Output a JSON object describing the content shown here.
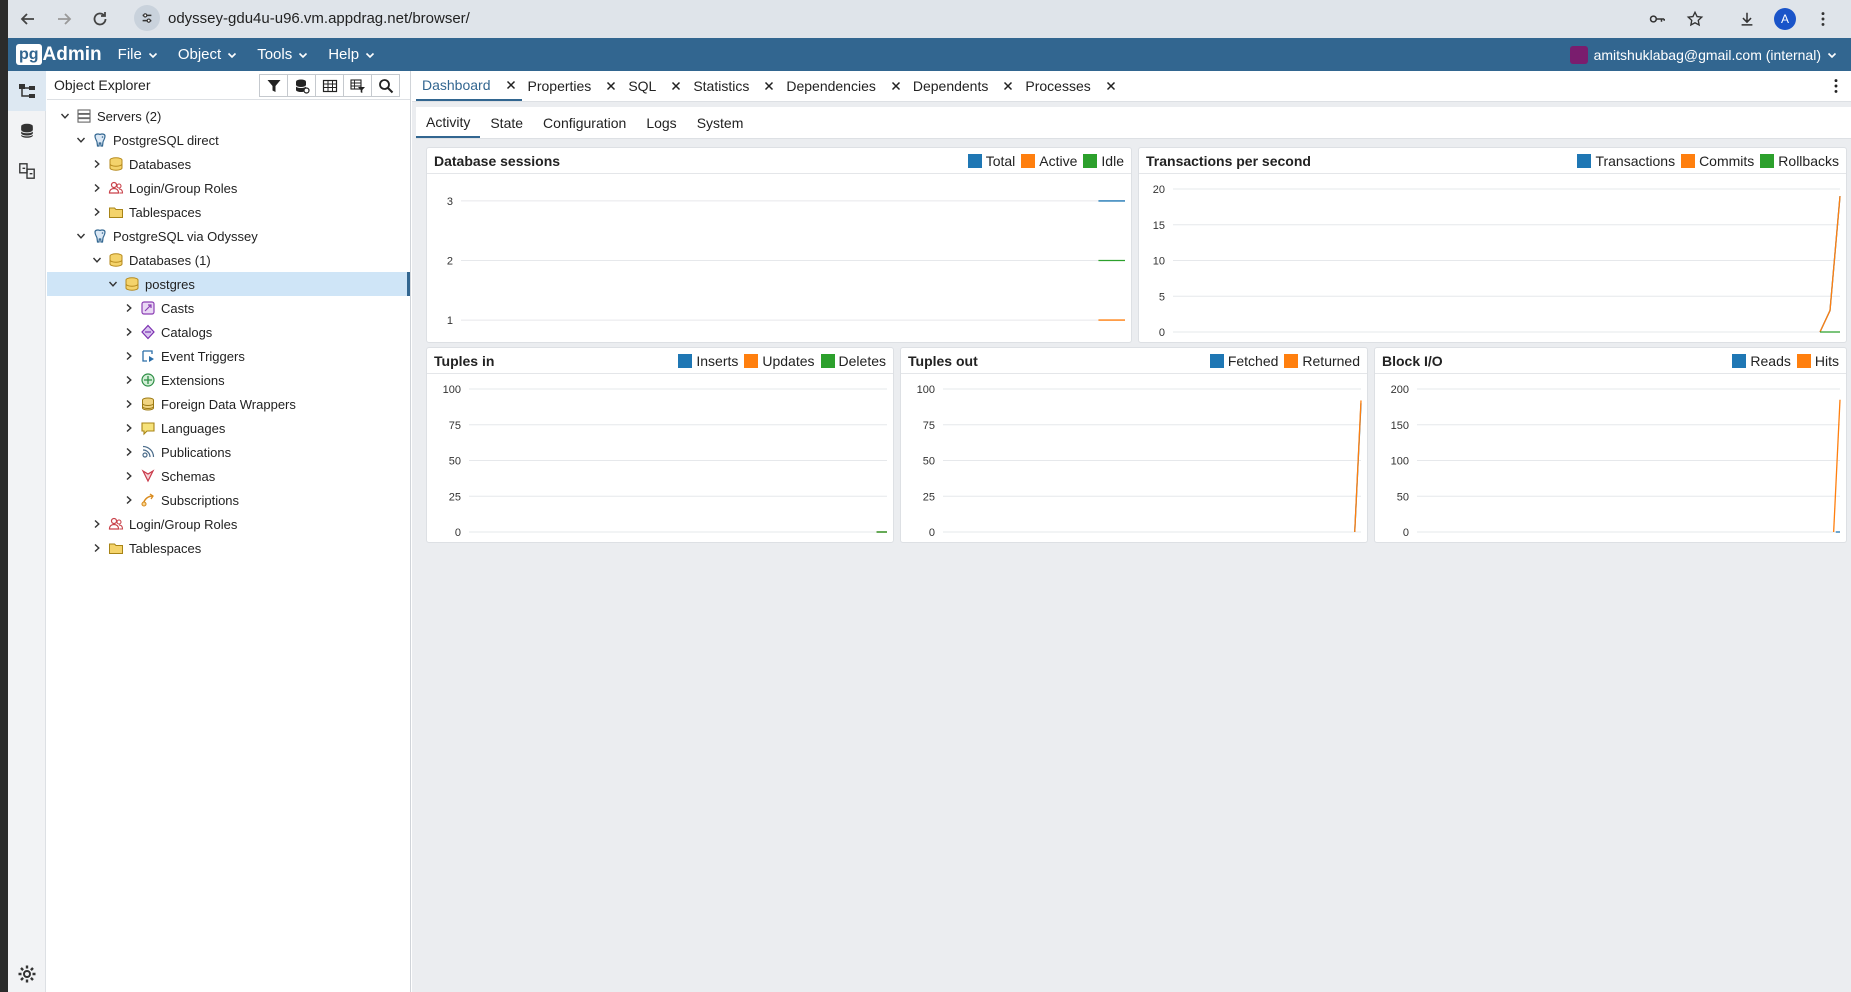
{
  "browser": {
    "url": "odyssey-gdu4u-u96.vm.appdrag.net/browser/",
    "profile_initial": "A"
  },
  "app": {
    "logo_pg": "pg",
    "logo_text": "Admin",
    "menus": [
      "File",
      "Object",
      "Tools",
      "Help"
    ],
    "user": "amitshuklabag@gmail.com (internal)"
  },
  "explorer": {
    "title": "Object Explorer",
    "tree": [
      {
        "label": "Servers (2)",
        "level": 0,
        "toggle": "open",
        "icon": "servers-icon"
      },
      {
        "label": "PostgreSQL direct",
        "level": 1,
        "toggle": "open",
        "icon": "elephant-icon"
      },
      {
        "label": "Databases",
        "level": 2,
        "toggle": "closed",
        "icon": "databases-icon"
      },
      {
        "label": "Login/Group Roles",
        "level": 2,
        "toggle": "closed",
        "icon": "roles-icon"
      },
      {
        "label": "Tablespaces",
        "level": 2,
        "toggle": "closed",
        "icon": "tablespaces-icon"
      },
      {
        "label": "PostgreSQL via Odyssey",
        "level": 1,
        "toggle": "open",
        "icon": "elephant-icon"
      },
      {
        "label": "Databases (1)",
        "level": 2,
        "toggle": "open",
        "icon": "databases-icon"
      },
      {
        "label": "postgres",
        "level": 3,
        "toggle": "open",
        "icon": "database-icon",
        "selected": true
      },
      {
        "label": "Casts",
        "level": 4,
        "toggle": "closed",
        "icon": "casts-icon"
      },
      {
        "label": "Catalogs",
        "level": 4,
        "toggle": "closed",
        "icon": "catalogs-icon"
      },
      {
        "label": "Event Triggers",
        "level": 4,
        "toggle": "closed",
        "icon": "event-triggers-icon"
      },
      {
        "label": "Extensions",
        "level": 4,
        "toggle": "closed",
        "icon": "extensions-icon"
      },
      {
        "label": "Foreign Data Wrappers",
        "level": 4,
        "toggle": "closed",
        "icon": "fdw-icon"
      },
      {
        "label": "Languages",
        "level": 4,
        "toggle": "closed",
        "icon": "languages-icon"
      },
      {
        "label": "Publications",
        "level": 4,
        "toggle": "closed",
        "icon": "publications-icon"
      },
      {
        "label": "Schemas",
        "level": 4,
        "toggle": "closed",
        "icon": "schemas-icon"
      },
      {
        "label": "Subscriptions",
        "level": 4,
        "toggle": "closed",
        "icon": "subscriptions-icon"
      },
      {
        "label": "Login/Group Roles",
        "level": 2,
        "toggle": "closed",
        "icon": "roles-icon"
      },
      {
        "label": "Tablespaces",
        "level": 2,
        "toggle": "closed",
        "icon": "tablespaces-icon"
      }
    ]
  },
  "tabs": [
    "Dashboard",
    "Properties",
    "SQL",
    "Statistics",
    "Dependencies",
    "Dependents",
    "Processes"
  ],
  "active_tab": 0,
  "subtabs": [
    "Activity",
    "State",
    "Configuration",
    "Logs",
    "System"
  ],
  "active_subtab": 0,
  "colors": {
    "blue": "#1f77b4",
    "orange": "#ff7f0e",
    "green": "#2ca02c",
    "accent": "#326690"
  },
  "chart_data": [
    {
      "id": "db-sessions",
      "type": "line",
      "title": "Database sessions",
      "legend": [
        "Total",
        "Active",
        "Idle"
      ],
      "yticks": [
        1,
        2,
        3
      ],
      "ylim": [
        0.8,
        3.2
      ],
      "series": [
        {
          "name": "Total",
          "color": "#1f77b4",
          "points": [
            [
              0.96,
              3
            ],
            [
              1.0,
              3
            ]
          ]
        },
        {
          "name": "Active",
          "color": "#ff7f0e",
          "points": [
            [
              0.96,
              1
            ],
            [
              1.0,
              1
            ]
          ]
        },
        {
          "name": "Idle",
          "color": "#2ca02c",
          "points": [
            [
              0.96,
              2
            ],
            [
              1.0,
              2
            ]
          ]
        }
      ]
    },
    {
      "id": "tps",
      "type": "line",
      "title": "Transactions per second",
      "legend": [
        "Transactions",
        "Commits",
        "Rollbacks"
      ],
      "yticks": [
        0,
        5,
        10,
        15,
        20
      ],
      "ylim": [
        0,
        20
      ],
      "series": [
        {
          "name": "Transactions",
          "color": "#1f77b4",
          "points": [
            [
              0.97,
              0
            ],
            [
              0.985,
              3
            ],
            [
              1.0,
              19
            ]
          ]
        },
        {
          "name": "Commits",
          "color": "#ff7f0e",
          "points": [
            [
              0.97,
              0
            ],
            [
              0.985,
              3
            ],
            [
              1.0,
              19
            ]
          ]
        },
        {
          "name": "Rollbacks",
          "color": "#2ca02c",
          "points": [
            [
              0.97,
              0
            ],
            [
              1.0,
              0
            ]
          ]
        }
      ]
    },
    {
      "id": "tuples-in",
      "type": "line",
      "title": "Tuples in",
      "legend": [
        "Inserts",
        "Updates",
        "Deletes"
      ],
      "yticks": [
        0,
        25,
        50,
        75,
        100
      ],
      "ylim": [
        0,
        100
      ],
      "series": [
        {
          "name": "Inserts",
          "color": "#1f77b4",
          "points": [
            [
              0.975,
              0
            ],
            [
              1.0,
              0
            ]
          ]
        },
        {
          "name": "Updates",
          "color": "#ff7f0e",
          "points": [
            [
              0.975,
              0
            ],
            [
              1.0,
              0
            ]
          ]
        },
        {
          "name": "Deletes",
          "color": "#2ca02c",
          "points": [
            [
              0.975,
              0
            ],
            [
              1.0,
              0
            ]
          ]
        }
      ]
    },
    {
      "id": "tuples-out",
      "type": "line",
      "title": "Tuples out",
      "legend": [
        "Fetched",
        "Returned"
      ],
      "yticks": [
        0,
        25,
        50,
        75,
        100
      ],
      "ylim": [
        0,
        100
      ],
      "series": [
        {
          "name": "Fetched",
          "color": "#1f77b4",
          "points": [
            [
              0.985,
              0
            ],
            [
              1.0,
              90
            ]
          ]
        },
        {
          "name": "Returned",
          "color": "#ff7f0e",
          "points": [
            [
              0.985,
              0
            ],
            [
              1.0,
              92
            ]
          ]
        }
      ]
    },
    {
      "id": "block-io",
      "type": "line",
      "title": "Block I/O",
      "legend": [
        "Reads",
        "Hits"
      ],
      "yticks": [
        0,
        50,
        100,
        150,
        200
      ],
      "ylim": [
        0,
        200
      ],
      "series": [
        {
          "name": "Reads",
          "color": "#1f77b4",
          "points": [
            [
              0.99,
              0
            ],
            [
              1.0,
              0
            ]
          ]
        },
        {
          "name": "Hits",
          "color": "#ff7f0e",
          "points": [
            [
              0.985,
              0
            ],
            [
              1.0,
              185
            ]
          ]
        }
      ]
    }
  ]
}
